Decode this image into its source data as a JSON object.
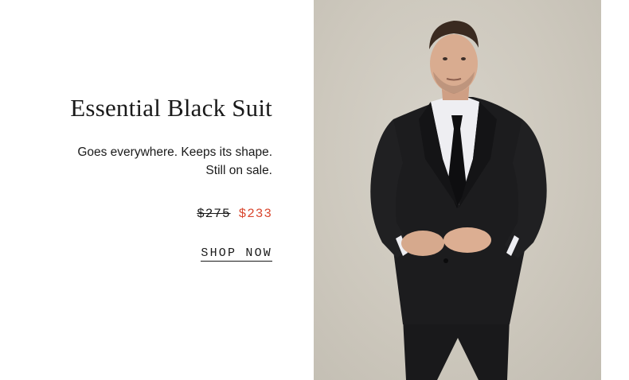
{
  "promo": {
    "headline": "Essential Black Suit",
    "tagline_line1": "Goes everywhere. Keeps its shape.",
    "tagline_line2": "Still on sale.",
    "price_original": "$275",
    "price_sale": "$233",
    "cta_label": "SHOP NOW"
  },
  "photo": {
    "subject": "model wearing black two-button suit, white shirt and black tie",
    "background_color": "#cfcac0"
  },
  "colors": {
    "text": "#1a1a1a",
    "sale_price": "#d9472f",
    "suit": "#1c1c1e"
  }
}
